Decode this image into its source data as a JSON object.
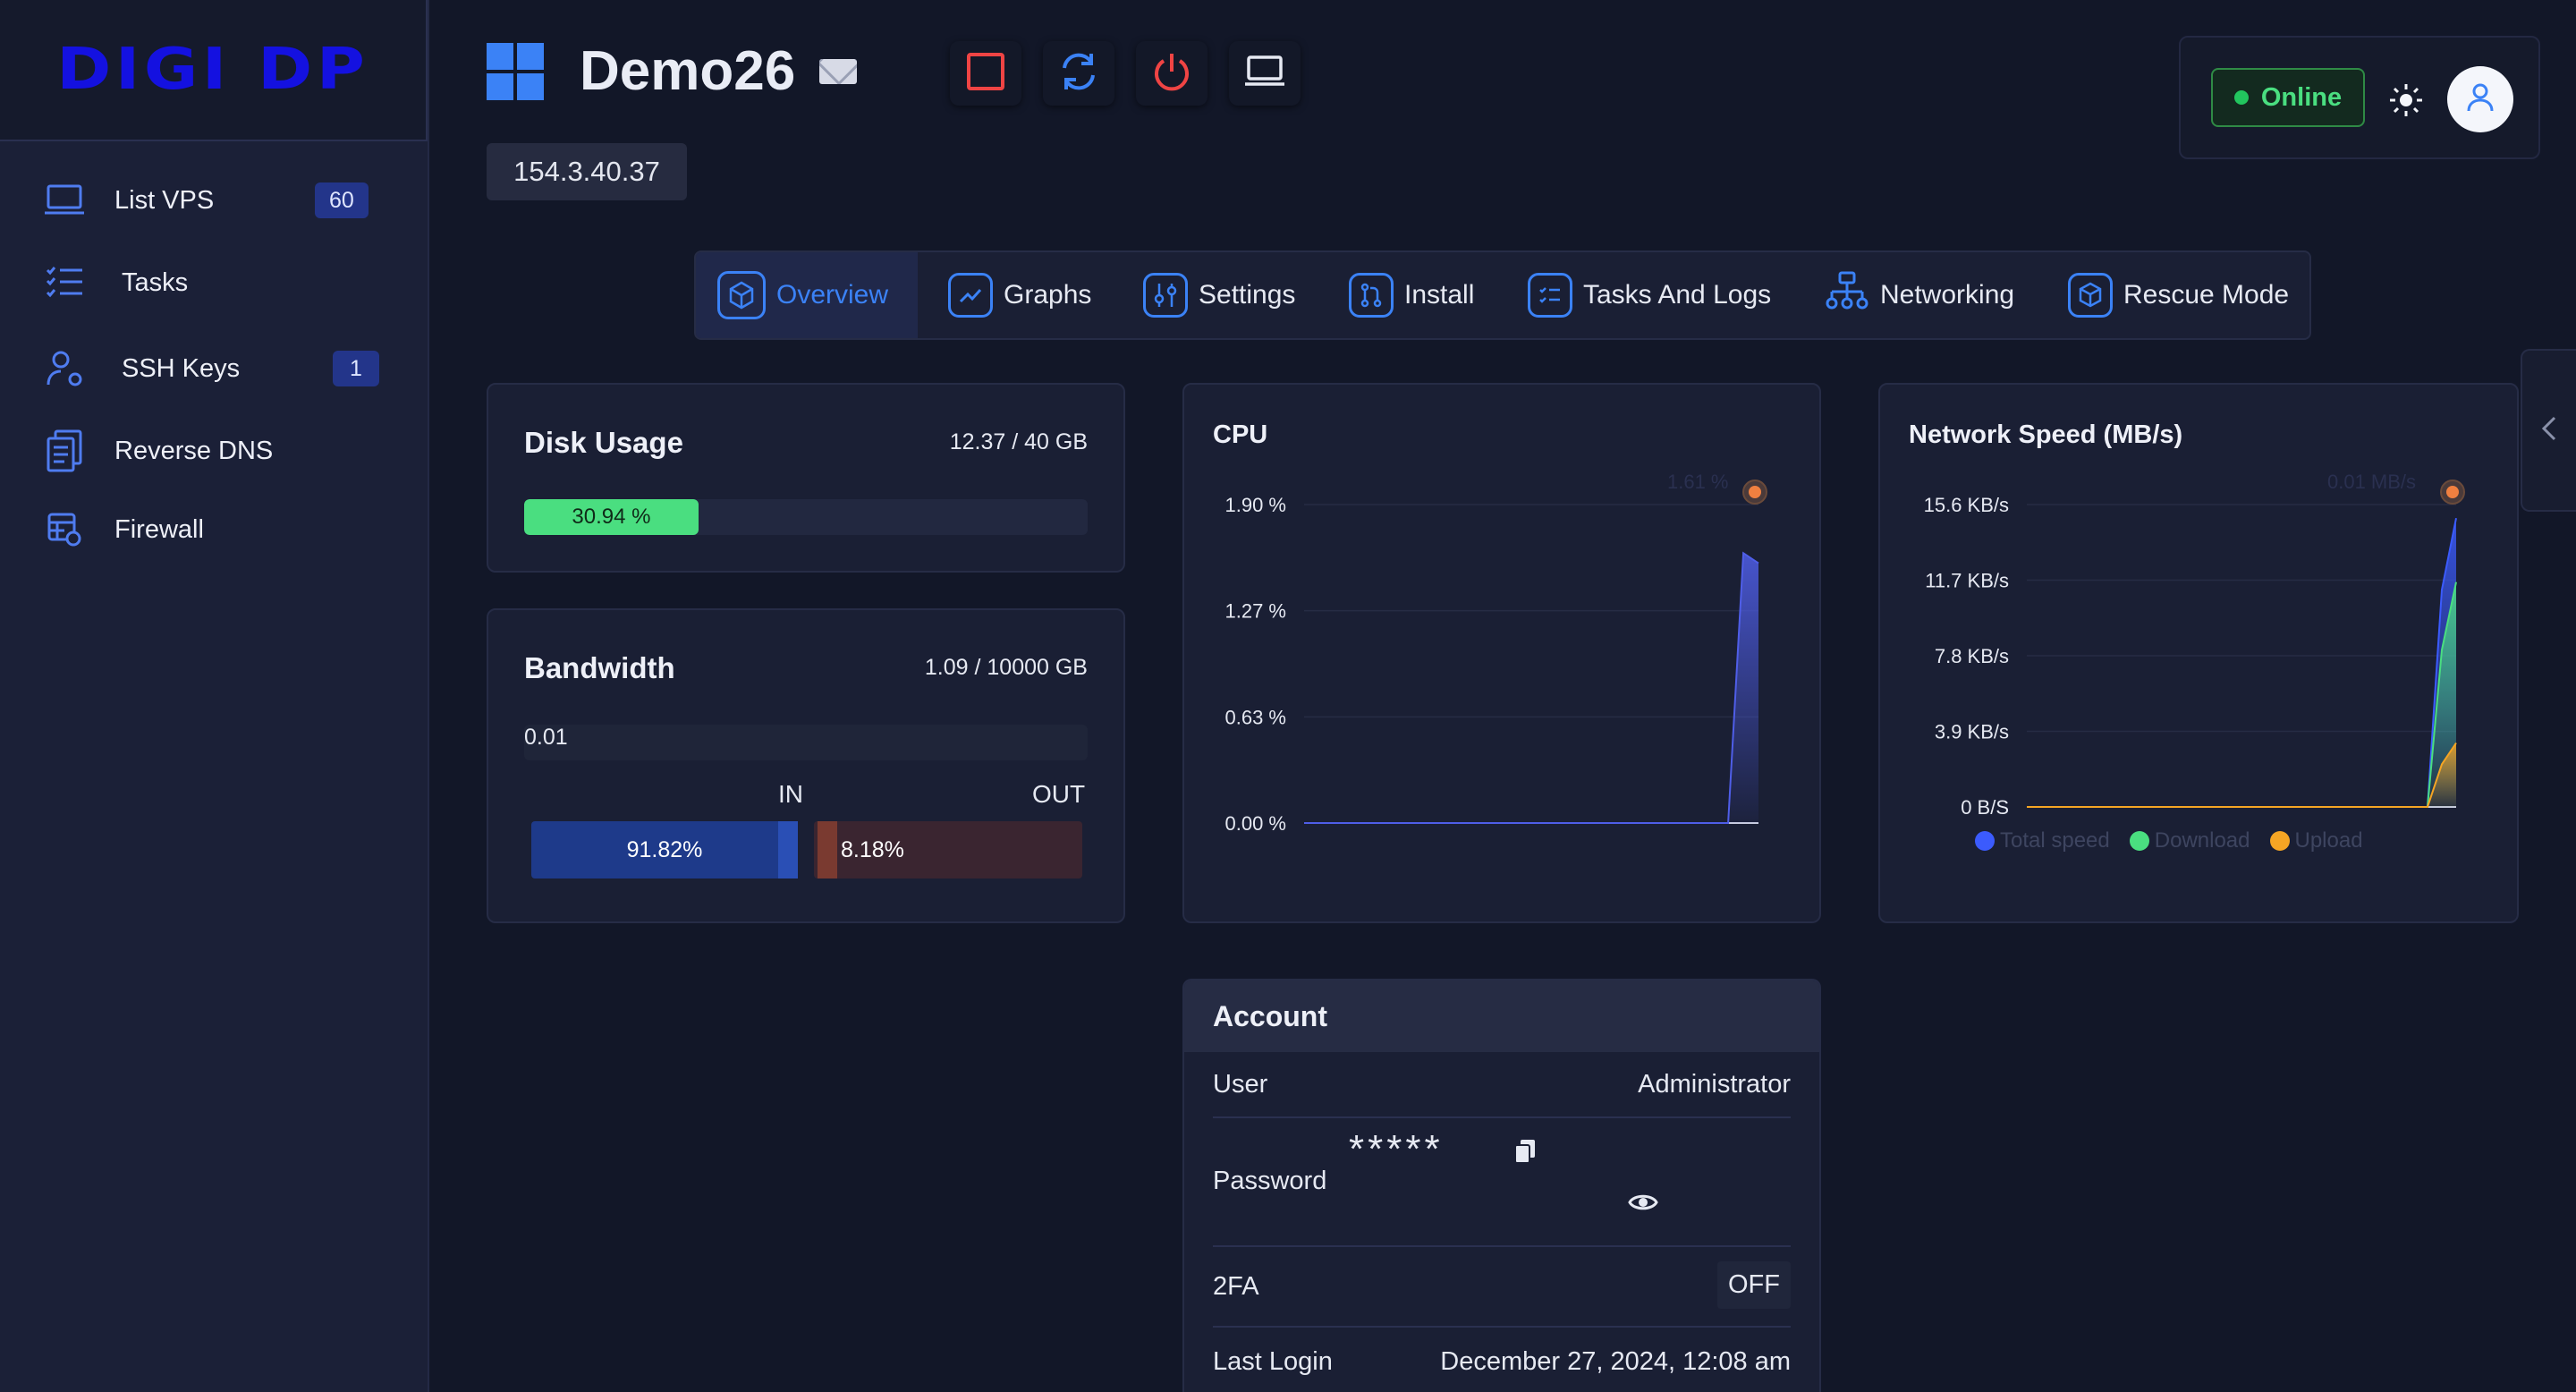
{
  "sidebar": {
    "logo_text": "DIGI DP",
    "items": [
      {
        "label": "List VPS",
        "badge": "60",
        "icon": "laptop-icon"
      },
      {
        "label": "Tasks",
        "badge": "",
        "icon": "checklist-icon"
      },
      {
        "label": "SSH Keys",
        "badge": "1",
        "icon": "user-key-icon"
      },
      {
        "label": "Reverse DNS",
        "badge": "",
        "icon": "dns-icon"
      },
      {
        "label": "Firewall",
        "badge": "",
        "icon": "firewall-icon"
      }
    ]
  },
  "header": {
    "server_name": "Demo26",
    "ip": "154.3.40.37",
    "status": "Online",
    "actions": [
      "stop-icon",
      "restart-icon",
      "power-icon",
      "console-icon"
    ],
    "colors": {
      "stop": "#ef4444",
      "restart": "#3b82f6",
      "power": "#ef4444",
      "console": "#e6e9f2"
    }
  },
  "tabs": [
    {
      "label": "Overview",
      "icon": "cube-icon",
      "active": true
    },
    {
      "label": "Graphs",
      "icon": "graph-icon",
      "active": false
    },
    {
      "label": "Settings",
      "icon": "sliders-icon",
      "active": false
    },
    {
      "label": "Install",
      "icon": "git-icon",
      "active": false
    },
    {
      "label": "Tasks And Logs",
      "icon": "list-icon",
      "active": false
    },
    {
      "label": "Networking",
      "icon": "network-icon",
      "active": false
    },
    {
      "label": "Rescue Mode",
      "icon": "rescue-icon",
      "active": false
    }
  ],
  "disk": {
    "title": "Disk Usage",
    "usage": "12.37 / 40 GB",
    "percent_label": "30.94 %",
    "percent": 30.94
  },
  "bandwidth": {
    "title": "Bandwidth",
    "usage": "1.09 / 10000 GB",
    "value_label": "0.01",
    "in_label": "IN",
    "out_label": "OUT",
    "in_percent": "91.82%",
    "out_percent": "8.18%"
  },
  "cpu": {
    "title": "CPU",
    "latest_label": "1.61 %"
  },
  "network": {
    "title": "Network Speed (MB/s)",
    "latest_label": "0.01 MB/s",
    "legend": [
      "Total speed",
      "Download",
      "Upload"
    ]
  },
  "chart_data": [
    {
      "type": "area",
      "title": "CPU",
      "y_ticks": [
        "1.90 %",
        "1.27 %",
        "0.63 %",
        "0.00 %"
      ],
      "ylim": [
        0,
        1.9
      ],
      "series": [
        {
          "values": [
            0,
            0,
            0,
            0,
            0,
            0,
            0,
            0,
            0,
            0,
            0,
            0,
            0,
            0,
            0,
            0,
            0,
            0,
            0,
            0,
            0,
            0,
            0,
            0,
            0,
            0,
            0,
            0,
            0,
            1.61,
            1.55
          ]
        }
      ],
      "colors": {
        "line": "#4f5ee8"
      },
      "grid": true
    },
    {
      "type": "area",
      "title": "Network Speed (MB/s)",
      "y_ticks": [
        "15.6 KB/s",
        "11.7 KB/s",
        "7.8 KB/s",
        "3.9 KB/s",
        "0 B/S"
      ],
      "ylim": [
        0,
        15.6
      ],
      "series": [
        {
          "name": "Total speed",
          "values": [
            0,
            0,
            0,
            0,
            0,
            0,
            0,
            0,
            0,
            0,
            0,
            0,
            0,
            0,
            0,
            0,
            0,
            0,
            0,
            0,
            0,
            0,
            0,
            0,
            0,
            0,
            0,
            0,
            0,
            11.2,
            14.9
          ]
        },
        {
          "name": "Download",
          "values": [
            0,
            0,
            0,
            0,
            0,
            0,
            0,
            0,
            0,
            0,
            0,
            0,
            0,
            0,
            0,
            0,
            0,
            0,
            0,
            0,
            0,
            0,
            0,
            0,
            0,
            0,
            0,
            0,
            0,
            8.1,
            11.6
          ]
        },
        {
          "name": "Upload",
          "values": [
            0,
            0,
            0,
            0,
            0,
            0,
            0,
            0,
            0,
            0,
            0,
            0,
            0,
            0,
            0,
            0,
            0,
            0,
            0,
            0,
            0,
            0,
            0,
            0,
            0,
            0,
            0,
            0,
            0,
            2.2,
            3.3
          ]
        }
      ],
      "colors": {
        "Total speed": "#3b5bfd",
        "Download": "#4ade80",
        "Upload": "#f5a524"
      },
      "legend_position": "bottom"
    }
  ],
  "account": {
    "title": "Account",
    "rows": [
      {
        "label": "User",
        "value": "Administrator"
      },
      {
        "label": "Password",
        "value": "*****"
      },
      {
        "label": "2FA",
        "value": "OFF"
      },
      {
        "label": "Last Login",
        "value": "December 27, 2024, 12:08 am"
      }
    ]
  }
}
